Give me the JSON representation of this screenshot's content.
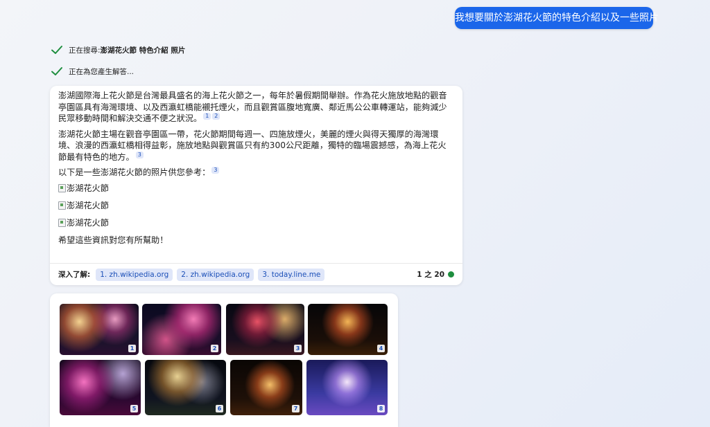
{
  "user_message": "我想要關於澎湖花火節的特色介紹以及一些照片",
  "status": [
    {
      "prefix": "正在搜尋: ",
      "query": "澎湖花火節 特色介紹 照片"
    },
    {
      "prefix": "正在為您產生解答...",
      "query": ""
    }
  ],
  "answer": {
    "p1": "澎湖國際海上花火節是台灣最具盛名的海上花火節之一，每年於暑假期間舉辦。作為花火施放地點的觀音亭園區具有海灣環境、以及西瀛虹橋能襯托煙火，而且觀賞區腹地寬廣、鄰近馬公公車轉運站，能夠減少民眾移動時間和解決交通不便之狀況。",
    "p1_cites": [
      "1",
      "2"
    ],
    "p2": "澎湖花火節主場在觀音亭園區一帶，花火節期間每週一、四施放煙火，美麗的煙火與得天獨厚的海灣環境、浪漫的西瀛虹橋相得益彰，施放地點與觀賞區只有約300公尺距離，獨特的臨場震撼感，為海上花火節最有特色的地方。",
    "p2_cites": [
      "3"
    ],
    "p3": "以下是一些澎湖花火節的照片供您參考：",
    "p3_cites": [
      "3"
    ],
    "image_alts": [
      "澎湖花火節",
      "澎湖花火節",
      "澎湖花火節"
    ],
    "closing": "希望這些資訊對您有所幫助！"
  },
  "learn_more": {
    "label": "深入了解:",
    "sources": [
      "1. zh.wikipedia.org",
      "2. zh.wikipedia.org",
      "3. today.line.me"
    ],
    "counter": "1 之 20",
    "counter_dot_color": "#1e8e3e"
  },
  "gallery": {
    "thumbnails": [
      "1",
      "2",
      "3",
      "4",
      "5",
      "6",
      "7",
      "8"
    ]
  },
  "colors": {
    "accent": "#1b66ea",
    "check": "#1e8e3e",
    "chip_bg": "#dfe6f9",
    "chip_text": "#1b4fb8"
  },
  "icons": {
    "status": "check-icon",
    "image_alt": "broken-image-icon"
  }
}
